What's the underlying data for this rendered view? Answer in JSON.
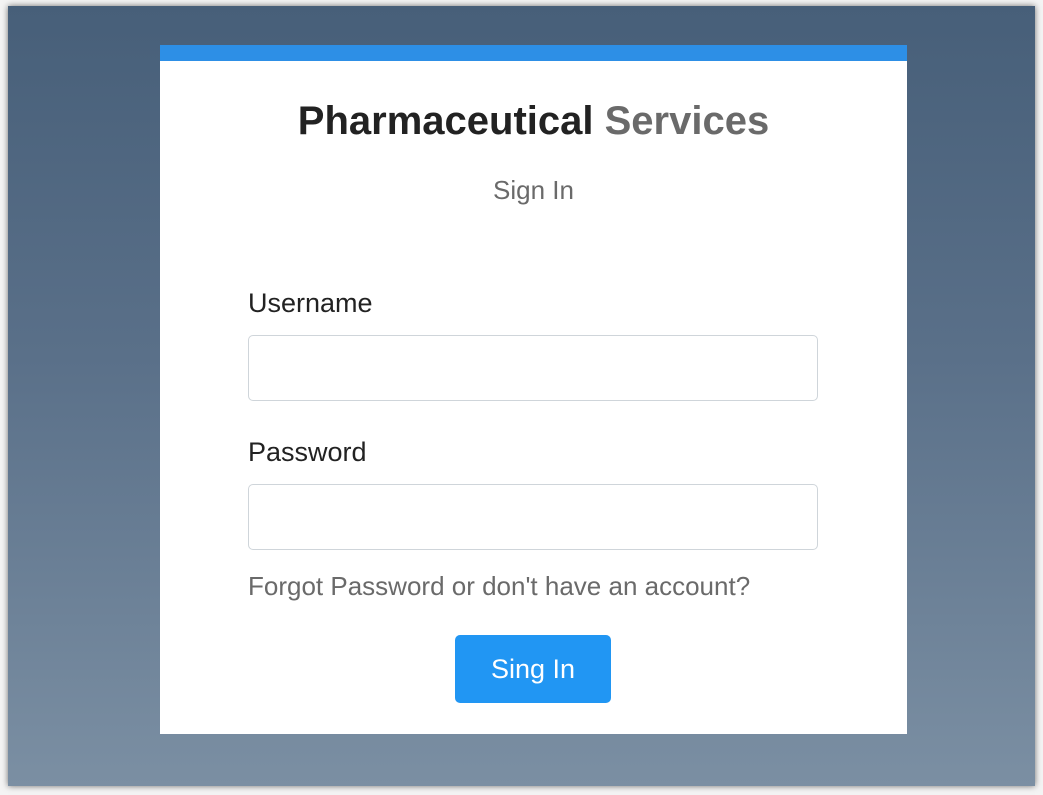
{
  "app": {
    "title_main": "Pharmaceutical",
    "title_rest": "Services"
  },
  "form": {
    "heading": "Sign In",
    "username_label": "Username",
    "username_value": "",
    "password_label": "Password",
    "password_value": "",
    "forgot_link": "Forgot Password or don't have an account?",
    "submit_label": "Sing In"
  },
  "colors": {
    "accent_bar": "#2d8fe6",
    "button": "#2196f3",
    "background_top": "#475f79",
    "background_bottom": "#7b8fa3"
  }
}
